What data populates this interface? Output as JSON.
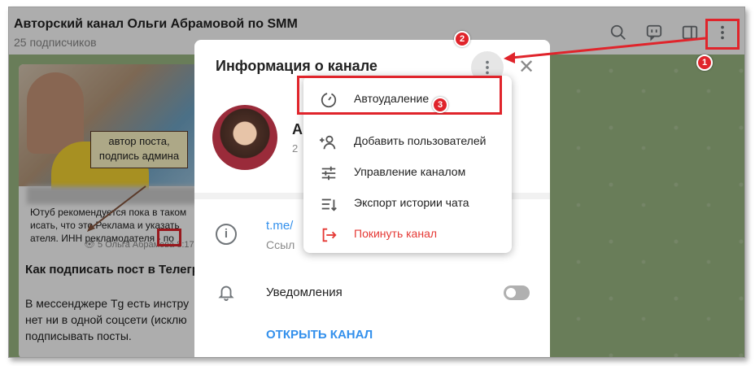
{
  "chat": {
    "title": "Авторский канал Ольги Абрамовой по SMM",
    "subscribers": "25 подписчиков",
    "post_preview": "Ютуб рекомендуется пока в таком исать, что это Реклама и указать ателя. ИНН рекламодателя - по",
    "post_author": "Ольга Абрамова",
    "post_views": "5",
    "post_time": "8:17",
    "note": "автор поста, подпись админа",
    "article_title": "Как подписать пост в Телеграм",
    "article_body_1": "В мессенджере Tg есть инстру",
    "article_body_2": "нет ни в одной соцсети (исклю",
    "article_body_3": "подписывать посты."
  },
  "dialog": {
    "title": "Информация о канале",
    "channel_name": "А",
    "channel_sub": "2",
    "link": "t.me/",
    "link_sub": "Ссыл",
    "notifications_label": "Уведомления",
    "notifications_on": false,
    "open_channel": "ОТКРЫТЬ КАНАЛ"
  },
  "menu": {
    "items": [
      {
        "label": "Автоудаление",
        "icon": "timer-icon"
      },
      {
        "label": "Добавить пользователей",
        "icon": "add-user-icon"
      },
      {
        "label": "Управление каналом",
        "icon": "sliders-icon"
      },
      {
        "label": "Экспорт истории чата",
        "icon": "export-icon"
      },
      {
        "label": "Покинуть канал",
        "icon": "leave-icon",
        "danger": true
      }
    ]
  },
  "annotations": {
    "badge_1": "1",
    "badge_2": "2",
    "badge_3": "3",
    "accent": "#e0242b"
  }
}
